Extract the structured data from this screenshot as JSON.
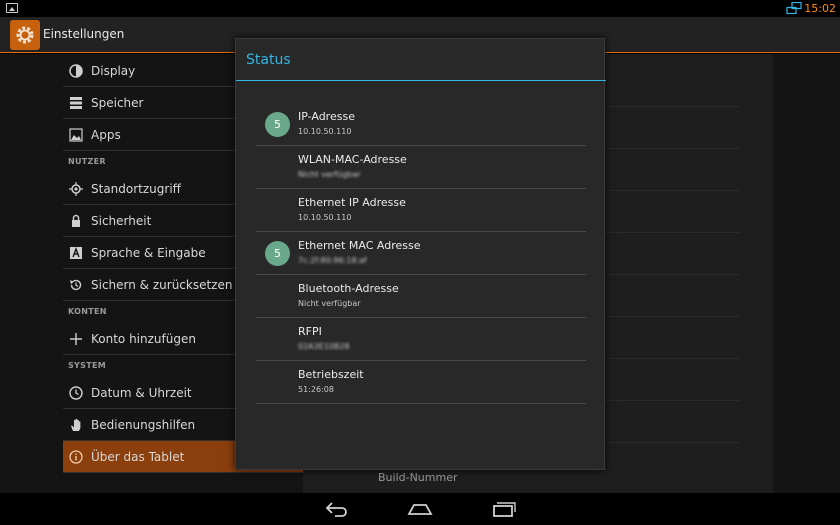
{
  "statusbar": {
    "time": "15:02",
    "icons": [
      "gallery-icon",
      "network-icon"
    ]
  },
  "actionbar": {
    "title": "Einstellungen",
    "icon": "settings-gear-icon"
  },
  "sidebar": {
    "items": [
      {
        "label": "Display",
        "icon": "brightness-icon"
      },
      {
        "label": "Speicher",
        "icon": "storage-icon"
      },
      {
        "label": "Apps",
        "icon": "apps-icon"
      },
      {
        "section": "NUTZER"
      },
      {
        "label": "Standortzugriff",
        "icon": "location-icon"
      },
      {
        "label": "Sicherheit",
        "icon": "lock-icon"
      },
      {
        "label": "Sprache & Eingabe",
        "icon": "keyboard-icon"
      },
      {
        "label": "Sichern & zurücksetzen",
        "icon": "restore-icon"
      },
      {
        "section": "KONTEN"
      },
      {
        "label": "Konto hinzufügen",
        "icon": "plus-icon"
      },
      {
        "section": "SYSTEM"
      },
      {
        "label": "Datum & Uhrzeit",
        "icon": "clock-icon"
      },
      {
        "label": "Bedienungshilfen",
        "icon": "hand-icon"
      },
      {
        "label": "Über das Tablet",
        "icon": "info-icon",
        "active": true
      }
    ],
    "accent": "#e36d10"
  },
  "background": {
    "build_label": "Build-Nummer"
  },
  "dialog": {
    "title": "Status",
    "accent": "#33b5e5",
    "rows": [
      {
        "label": "IP-Adresse",
        "value": "10.10.50.110",
        "badge": "5"
      },
      {
        "label": "WLAN-MAC-Adresse",
        "value": "Nicht verfügbar",
        "blurred": true
      },
      {
        "label": "Ethernet IP Adresse",
        "value": "10.10.50.110"
      },
      {
        "label": "Ethernet MAC Adresse",
        "value": "7c:2f:80:96:18:af",
        "badge": "5",
        "blurred": true
      },
      {
        "label": "Bluetooth-Adresse",
        "value": "Nicht verfügbar"
      },
      {
        "label": "RFPI",
        "value": "02A3E10B28",
        "blurred": true
      },
      {
        "label": "Betriebszeit",
        "value": "51:26:08"
      }
    ]
  },
  "navbar": {
    "buttons": [
      "back-icon",
      "home-icon",
      "recent-apps-icon"
    ]
  }
}
